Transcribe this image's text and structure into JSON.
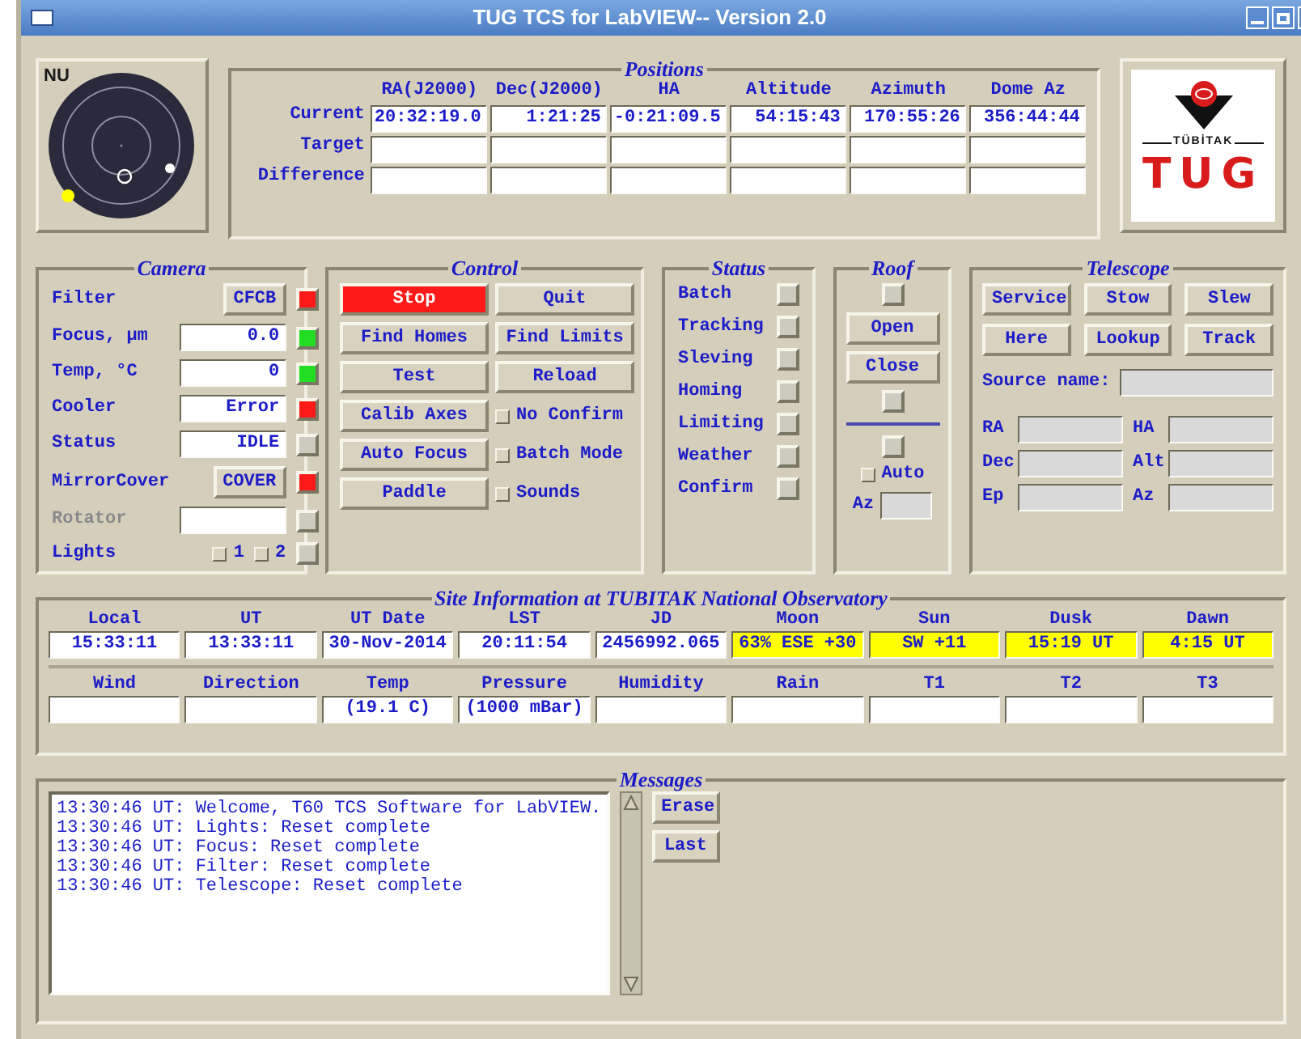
{
  "window": {
    "title": "TUG TCS for LabVIEW-- Version 2.0"
  },
  "sky_map": {
    "label": "NU"
  },
  "logo": {
    "org": "TÜBİTAK",
    "name": "TUG"
  },
  "positions": {
    "title": "Positions",
    "columns": [
      "RA(J2000)",
      "Dec(J2000)",
      "HA",
      "Altitude",
      "Azimuth",
      "Dome Az"
    ],
    "rows": [
      {
        "label": "Current",
        "values": [
          "20:32:19.0",
          "1:21:25",
          "-0:21:09.5",
          "54:15:43",
          "170:55:26",
          "356:44:44"
        ]
      },
      {
        "label": "Target"
      },
      {
        "label": "Difference"
      }
    ]
  },
  "camera": {
    "title": "Camera",
    "rows": [
      {
        "kind": "button",
        "label": "Filter",
        "value": "CFCB",
        "color": "#ff1a1a",
        "disabled": false
      },
      {
        "kind": "field",
        "label": "Focus, µm",
        "value": "0.0",
        "color": "#22dd22",
        "disabled": false
      },
      {
        "kind": "field",
        "label": "Temp, °C",
        "value": "0",
        "color": "#22dd22",
        "disabled": false
      },
      {
        "kind": "field",
        "label": "Cooler",
        "value": "Error",
        "color": "#ff1a1a",
        "disabled": false
      },
      {
        "kind": "field",
        "label": "Status",
        "value": "IDLE",
        "color": "#cdcac0",
        "disabled": false
      },
      {
        "kind": "button",
        "label": "MirrorCover",
        "value": "COVER",
        "color": "#ff1a1a",
        "disabled": false
      },
      {
        "kind": "field",
        "label": "Rotator",
        "color": "#cdcac0",
        "disabled": true
      },
      {
        "kind": "checks",
        "label": "Lights",
        "checks": [
          {
            "label": "1",
            "checked": false
          },
          {
            "label": "2",
            "checked": false
          }
        ],
        "color": "#cdcac0",
        "disabled": false
      }
    ]
  },
  "control": {
    "title": "Control",
    "items": [
      {
        "kind": "button",
        "label": "Stop",
        "highlighted": true
      },
      {
        "kind": "button",
        "label": "Quit",
        "highlighted": false
      },
      {
        "kind": "button",
        "label": "Find Homes",
        "highlighted": false
      },
      {
        "kind": "button",
        "label": "Find Limits",
        "highlighted": false
      },
      {
        "kind": "button",
        "label": "Test",
        "highlighted": false
      },
      {
        "kind": "button",
        "label": "Reload",
        "highlighted": false
      },
      {
        "kind": "button",
        "label": "Calib Axes",
        "highlighted": false
      },
      {
        "kind": "check",
        "label": "No Confirm",
        "checked": false
      },
      {
        "kind": "button",
        "label": "Auto Focus",
        "highlighted": false
      },
      {
        "kind": "check",
        "label": "Batch Mode",
        "checked": false
      },
      {
        "kind": "button",
        "label": "Paddle",
        "highlighted": false
      },
      {
        "kind": "check",
        "label": "Sounds",
        "checked": false
      }
    ]
  },
  "status": {
    "title": "Status",
    "items": [
      {
        "label": "Batch",
        "on": false
      },
      {
        "label": "Tracking",
        "on": false
      },
      {
        "label": "Sleving",
        "on": false
      },
      {
        "label": "Homing",
        "on": false
      },
      {
        "label": "Limiting",
        "on": false
      },
      {
        "label": "Weather",
        "on": false
      },
      {
        "label": "Confirm",
        "on": false
      }
    ]
  },
  "roof": {
    "title": "Roof",
    "items": [
      {
        "kind": "led",
        "on": false
      },
      {
        "kind": "button",
        "label": "Open"
      },
      {
        "kind": "button",
        "label": "Close"
      },
      {
        "kind": "led",
        "on": false
      },
      {
        "kind": "divider"
      },
      {
        "kind": "led",
        "on": false
      },
      {
        "kind": "check",
        "label": "Auto",
        "checked": false
      },
      {
        "kind": "field",
        "label": "Az"
      }
    ]
  },
  "telescope": {
    "title": "Telescope",
    "buttons": [
      "Service",
      "Stow",
      "Slew",
      "Here",
      "Lookup",
      "Track"
    ],
    "source_label": "Source name:",
    "fields": [
      {
        "label": "RA"
      },
      {
        "label": "HA"
      },
      {
        "label": "Dec"
      },
      {
        "label": "Alt"
      },
      {
        "label": "Ep"
      },
      {
        "label": "Az"
      }
    ]
  },
  "site": {
    "title": "Site Information at TUBITAK National Observatory",
    "rows": [
      [
        {
          "label": "Local",
          "value": "15:33:11",
          "highlighted": false
        },
        {
          "label": "UT",
          "value": "13:33:11",
          "highlighted": false
        },
        {
          "label": "UT Date",
          "value": "30-Nov-2014",
          "highlighted": false
        },
        {
          "label": "LST",
          "value": "20:11:54",
          "highlighted": false
        },
        {
          "label": "JD",
          "value": "2456992.065",
          "highlighted": false
        },
        {
          "label": "Moon",
          "value": "63% ESE +30",
          "highlighted": true
        },
        {
          "label": "Sun",
          "value": "SW +11",
          "highlighted": true
        },
        {
          "label": "Dusk",
          "value": "15:19 UT",
          "highlighted": true
        },
        {
          "label": "Dawn",
          "value": "4:15 UT",
          "highlighted": true
        }
      ],
      [
        {
          "label": "Wind",
          "highlighted": false
        },
        {
          "label": "Direction",
          "highlighted": false
        },
        {
          "label": "Temp",
          "value": "(19.1 C)",
          "highlighted": false
        },
        {
          "label": "Pressure",
          "value": "(1000 mBar)",
          "highlighted": false
        },
        {
          "label": "Humidity",
          "highlighted": false
        },
        {
          "label": "Rain",
          "highlighted": false
        },
        {
          "label": "T1",
          "highlighted": false
        },
        {
          "label": "T2",
          "highlighted": false
        },
        {
          "label": "T3",
          "highlighted": false
        }
      ]
    ]
  },
  "messages": {
    "title": "Messages",
    "lines": [
      "13:30:46 UT: Welcome, T60 TCS Software for LabVIEW.",
      "13:30:46 UT: Lights: Reset complete",
      "13:30:46 UT: Focus: Reset complete",
      "13:30:46 UT: Filter: Reset complete",
      "13:30:46 UT: Telescope: Reset complete"
    ],
    "buttons": [
      "Erase",
      "Last"
    ]
  }
}
